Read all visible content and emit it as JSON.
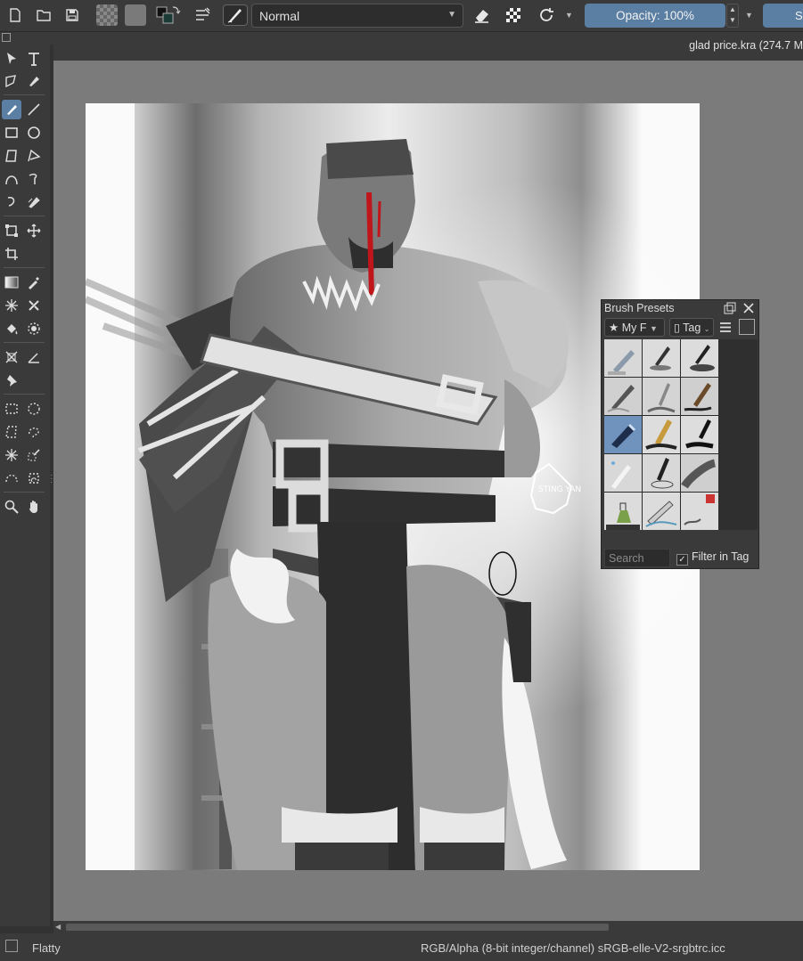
{
  "toolbar": {
    "blending_mode": "Normal",
    "opacity_label": "Opacity: 100%",
    "size_label_partial": "S",
    "icons": [
      "new-document-icon",
      "open-folder-icon",
      "save-icon",
      "gradient-pattern-icon",
      "fill-pattern-icon",
      "fg-bg-color-icon",
      "brush-settings-icon",
      "brush-preset-icon",
      "eraser-icon",
      "alpha-lock-icon",
      "reload-preset-icon"
    ]
  },
  "document": {
    "tab_title": "glad price.kra (274.7 M"
  },
  "brush_presets": {
    "title": "Brush Presets",
    "tag_filter": "My F",
    "tag_button": "Tag",
    "search_placeholder": "Search",
    "filter_in_tag_label": "Filter in Tag",
    "filter_in_tag_checked": true,
    "selected_index": 6
  },
  "canvas": {
    "signature_text": "STING YAN"
  },
  "statusbar": {
    "theme": "Flatty",
    "color_info": "RGB/Alpha (8-bit integer/channel)  sRGB-elle-V2-srgbtrc.icc"
  },
  "colors": {
    "accent": "#5a7fa3",
    "panel": "#3a3a3a",
    "canvas_bg": "#7b7b7b",
    "blood_red": "#c0151b"
  }
}
